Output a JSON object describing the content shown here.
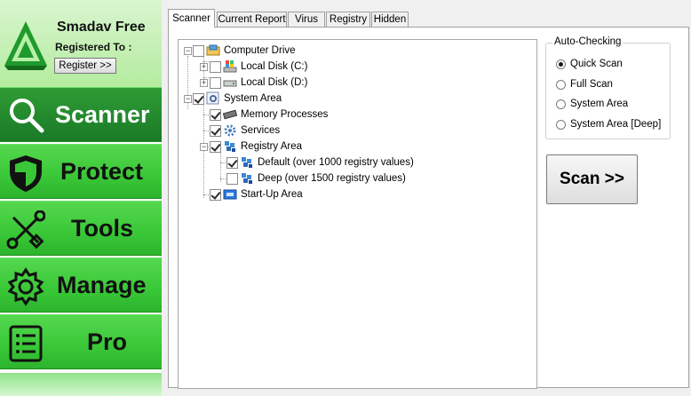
{
  "brand": {
    "title": "Smadav Free",
    "registered_to": "Registered To :",
    "register_button": "Register >>"
  },
  "nav": [
    {
      "label": "Scanner",
      "icon": "magnifier-icon",
      "active": true
    },
    {
      "label": "Protect",
      "icon": "shield-icon",
      "active": false
    },
    {
      "label": "Tools",
      "icon": "wrench-screwdriver-icon",
      "active": false
    },
    {
      "label": "Manage",
      "icon": "gear-icon",
      "active": false
    },
    {
      "label": "Pro",
      "icon": "list-document-icon",
      "active": false
    }
  ],
  "tabs": [
    {
      "label": "Scanner",
      "active": true
    },
    {
      "label": "Current Report",
      "active": false
    },
    {
      "label": "Virus",
      "active": false
    },
    {
      "label": "Registry",
      "active": false
    },
    {
      "label": "Hidden",
      "active": false
    }
  ],
  "tree": [
    {
      "label": "Computer Drive",
      "checked": false,
      "icon": "computer-drive-icon",
      "level": 0,
      "expander": "-"
    },
    {
      "label": "Local Disk (C:)",
      "checked": false,
      "icon": "windows-disk-icon",
      "level": 1,
      "expander": "+"
    },
    {
      "label": "Local Disk (D:)",
      "checked": false,
      "icon": "disk-icon",
      "level": 1,
      "expander": "+"
    },
    {
      "label": "System Area",
      "checked": true,
      "icon": "system-area-icon",
      "level": 0,
      "expander": "-"
    },
    {
      "label": "Memory Processes",
      "checked": true,
      "icon": "memory-icon",
      "level": 1,
      "expander": ""
    },
    {
      "label": "Services",
      "checked": true,
      "icon": "services-icon",
      "level": 1,
      "expander": ""
    },
    {
      "label": "Registry Area",
      "checked": true,
      "icon": "registry-icon",
      "level": 1,
      "expander": "-"
    },
    {
      "label": "Default (over 1000 registry values)",
      "checked": true,
      "icon": "registry-icon",
      "level": 2,
      "expander": ""
    },
    {
      "label": "Deep (over 1500 registry values)",
      "checked": false,
      "icon": "registry-icon",
      "level": 2,
      "expander": ""
    },
    {
      "label": "Start-Up Area",
      "checked": true,
      "icon": "startup-icon",
      "level": 1,
      "expander": ""
    }
  ],
  "auto_checking": {
    "title": "Auto-Checking",
    "options": [
      {
        "label": "Quick Scan",
        "selected": true
      },
      {
        "label": "Full Scan",
        "selected": false
      },
      {
        "label": "System Area",
        "selected": false
      },
      {
        "label": "System Area [Deep]",
        "selected": false
      }
    ]
  },
  "scan_button": "Scan >>",
  "colors": {
    "nav_green": "#39c737",
    "nav_active": "#1a7a27",
    "brand_bg": "#c6f0b6"
  }
}
